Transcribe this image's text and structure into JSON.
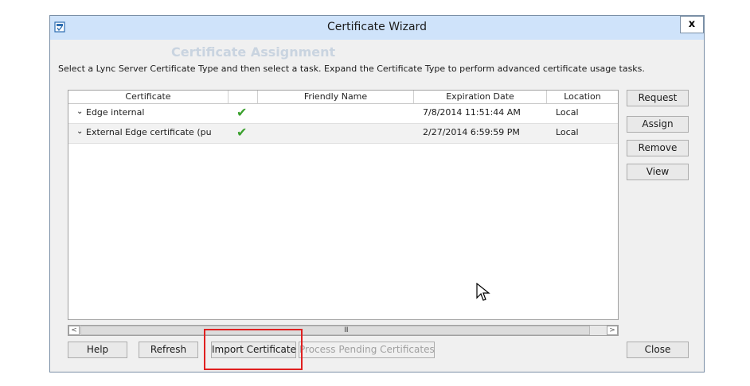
{
  "window": {
    "title": "Certificate Wizard",
    "close_label": "x"
  },
  "background_ghost": {
    "heading": "Certificate Assignment"
  },
  "instruction": "Select a Lync Server Certificate Type and then select a task. Expand the Certificate Type to perform advanced certificate usage tasks.",
  "grid": {
    "columns": [
      "Certificate",
      "",
      "Friendly Name",
      "Expiration Date",
      "Location"
    ],
    "rows": [
      {
        "certificate": "Edge internal",
        "status_icon": "checkmark-icon",
        "friendly_name": "",
        "expiration": "7/8/2014 11:51:44 AM",
        "location": "Local"
      },
      {
        "certificate": "External Edge certificate (pu",
        "status_icon": "checkmark-icon",
        "friendly_name": "",
        "expiration": "2/27/2014 6:59:59 PM",
        "location": "Local"
      }
    ]
  },
  "scrollbar": {
    "left_arrow": "<",
    "right_arrow": ">",
    "grip": "III"
  },
  "side_buttons": {
    "request": "Request",
    "assign": "Assign",
    "remove": "Remove",
    "view": "View"
  },
  "bottom_buttons": {
    "help": "Help",
    "refresh": "Refresh",
    "import": "Import Certificate",
    "process_pending": "Process Pending Certificates",
    "close": "Close"
  },
  "colors": {
    "titlebar": "#cfe3fa",
    "highlight": "#e02020",
    "check": "#3aa02d"
  }
}
